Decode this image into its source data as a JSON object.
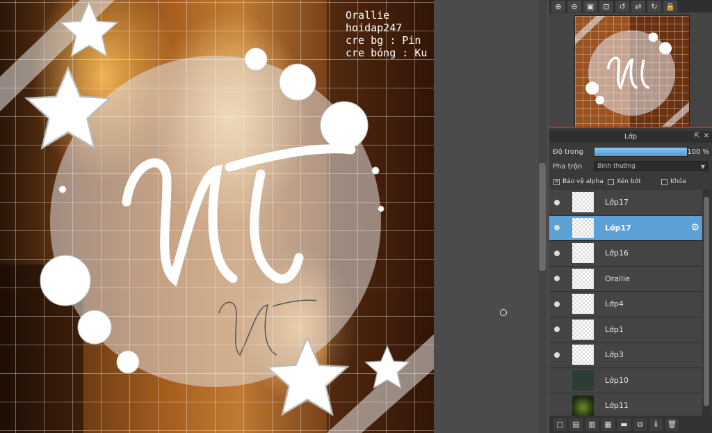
{
  "artwork": {
    "credits": [
      "Orallie",
      "hoidap247",
      "cre bg : Pin",
      "cre bóng : Ku"
    ]
  },
  "navigator": {
    "tools": [
      {
        "name": "zoom-in-icon",
        "glyph": "⊕"
      },
      {
        "name": "zoom-out-icon",
        "glyph": "⊖"
      },
      {
        "name": "fit-icon",
        "glyph": "▣"
      },
      {
        "name": "actual-size-icon",
        "glyph": "⊡"
      },
      {
        "name": "rotate-left-icon",
        "glyph": "↺"
      },
      {
        "name": "flip-icon",
        "glyph": "⇄"
      },
      {
        "name": "rotate-right-icon",
        "glyph": "↻"
      },
      {
        "name": "lock-icon",
        "glyph": "🔒"
      }
    ]
  },
  "layers_panel": {
    "title": "Lớp",
    "opacity_label": "Độ trong",
    "opacity_value": "100 %",
    "opacity_fraction": 1.0,
    "blend_label": "Pha trộn",
    "blend_value": "Bình thường",
    "checkboxes": [
      {
        "label": "Bảo vệ alpha",
        "checked": true
      },
      {
        "label": "Xén bớt",
        "checked": false
      },
      {
        "label": "Khóa",
        "checked": false
      }
    ],
    "layers": [
      {
        "name": "Lớp17",
        "visible": true,
        "selected": false,
        "thumb": "transparent"
      },
      {
        "name": "Lớp17",
        "visible": true,
        "selected": true,
        "thumb": "transparent"
      },
      {
        "name": "Lớp16",
        "visible": true,
        "selected": false,
        "thumb": "transparent"
      },
      {
        "name": "Orallie",
        "visible": true,
        "selected": false,
        "thumb": "transparent"
      },
      {
        "name": "Lớp4",
        "visible": true,
        "selected": false,
        "thumb": "transparent"
      },
      {
        "name": "Lớp1",
        "visible": true,
        "selected": false,
        "thumb": "transparent"
      },
      {
        "name": "Lớp3",
        "visible": true,
        "selected": false,
        "thumb": "transparent"
      },
      {
        "name": "Lớp10",
        "visible": false,
        "selected": false,
        "thumb": "dark"
      },
      {
        "name": "Lớp11",
        "visible": false,
        "selected": false,
        "thumb": "green"
      }
    ],
    "bottom_tools": [
      {
        "name": "new-layer-icon",
        "glyph": "▢"
      },
      {
        "name": "new-raster-icon",
        "glyph": "▤"
      },
      {
        "name": "new-vector-icon",
        "glyph": "▥"
      },
      {
        "name": "add-special-layer-icon",
        "glyph": "▦"
      },
      {
        "name": "folder-icon",
        "glyph": "▬"
      },
      {
        "name": "duplicate-icon",
        "glyph": "⧉"
      },
      {
        "name": "merge-down-icon",
        "glyph": "⇓"
      },
      {
        "name": "trash-icon",
        "glyph": "🗑"
      }
    ]
  }
}
